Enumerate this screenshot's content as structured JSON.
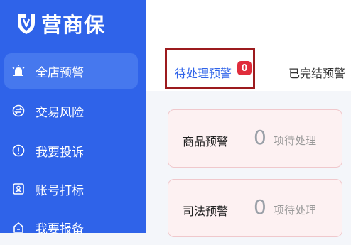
{
  "app": {
    "brand_name": "营商保"
  },
  "sidebar": {
    "items": [
      {
        "label": "全店预警",
        "icon": "alarm-bell-icon",
        "active": true
      },
      {
        "label": "交易风险",
        "icon": "transfer-icon",
        "active": false
      },
      {
        "label": "我要投诉",
        "icon": "alert-icon",
        "active": false
      },
      {
        "label": "账号打标",
        "icon": "account-tag-icon",
        "active": false
      },
      {
        "label": "我要报备",
        "icon": "report-icon",
        "active": false
      }
    ]
  },
  "tabs": [
    {
      "label": "待处理预警",
      "badge": "0",
      "active": true
    },
    {
      "label": "已完结预警",
      "active": false
    }
  ],
  "cards": [
    {
      "label": "商品预警",
      "count": "0",
      "suffix": "项待处理"
    },
    {
      "label": "司法预警",
      "count": "0",
      "suffix": "项待处理"
    }
  ],
  "colors": {
    "primary": "#2f63e9",
    "badge": "#e02d3c",
    "highlight": "#9c1b1e"
  }
}
